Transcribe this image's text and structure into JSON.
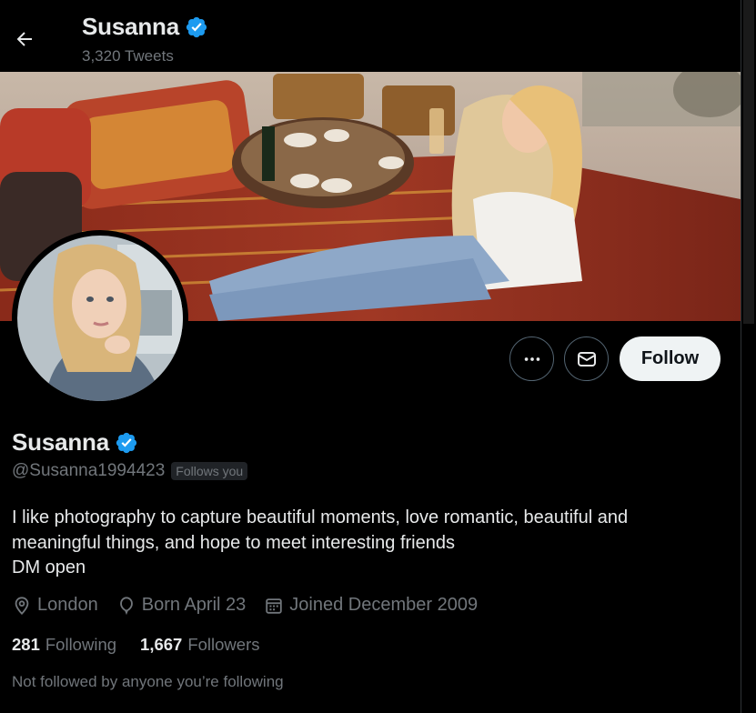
{
  "header": {
    "name": "Susanna",
    "tweet_count": "3,320 Tweets"
  },
  "actions": {
    "follow_label": "Follow"
  },
  "profile": {
    "display_name": "Susanna",
    "handle": "@Susanna1994423",
    "follows_you": "Follows you",
    "bio_lines": [
      "I like photography to capture beautiful moments, love romantic, beautiful and",
      "meaningful things, and hope to meet interesting friends",
      "DM open"
    ],
    "location": "London",
    "birthday": "Born April 23",
    "joined": "Joined December 2009"
  },
  "stats": {
    "following_count": "281",
    "following_label": "Following",
    "followers_count": "1,667",
    "followers_label": "Followers"
  },
  "footer": {
    "not_followed": "Not followed by anyone you’re following"
  },
  "icons": {
    "back": "arrow-left-icon",
    "verified": "verified-badge-icon",
    "more": "ellipsis-icon",
    "message": "envelope-icon",
    "location": "location-pin-icon",
    "birthday": "balloon-icon",
    "joined": "calendar-icon"
  },
  "colors": {
    "background": "#000000",
    "text_primary": "#e7e9ea",
    "text_secondary": "#71767b",
    "verified_blue": "#1d9bf0",
    "follow_button_bg": "#eff3f4"
  }
}
